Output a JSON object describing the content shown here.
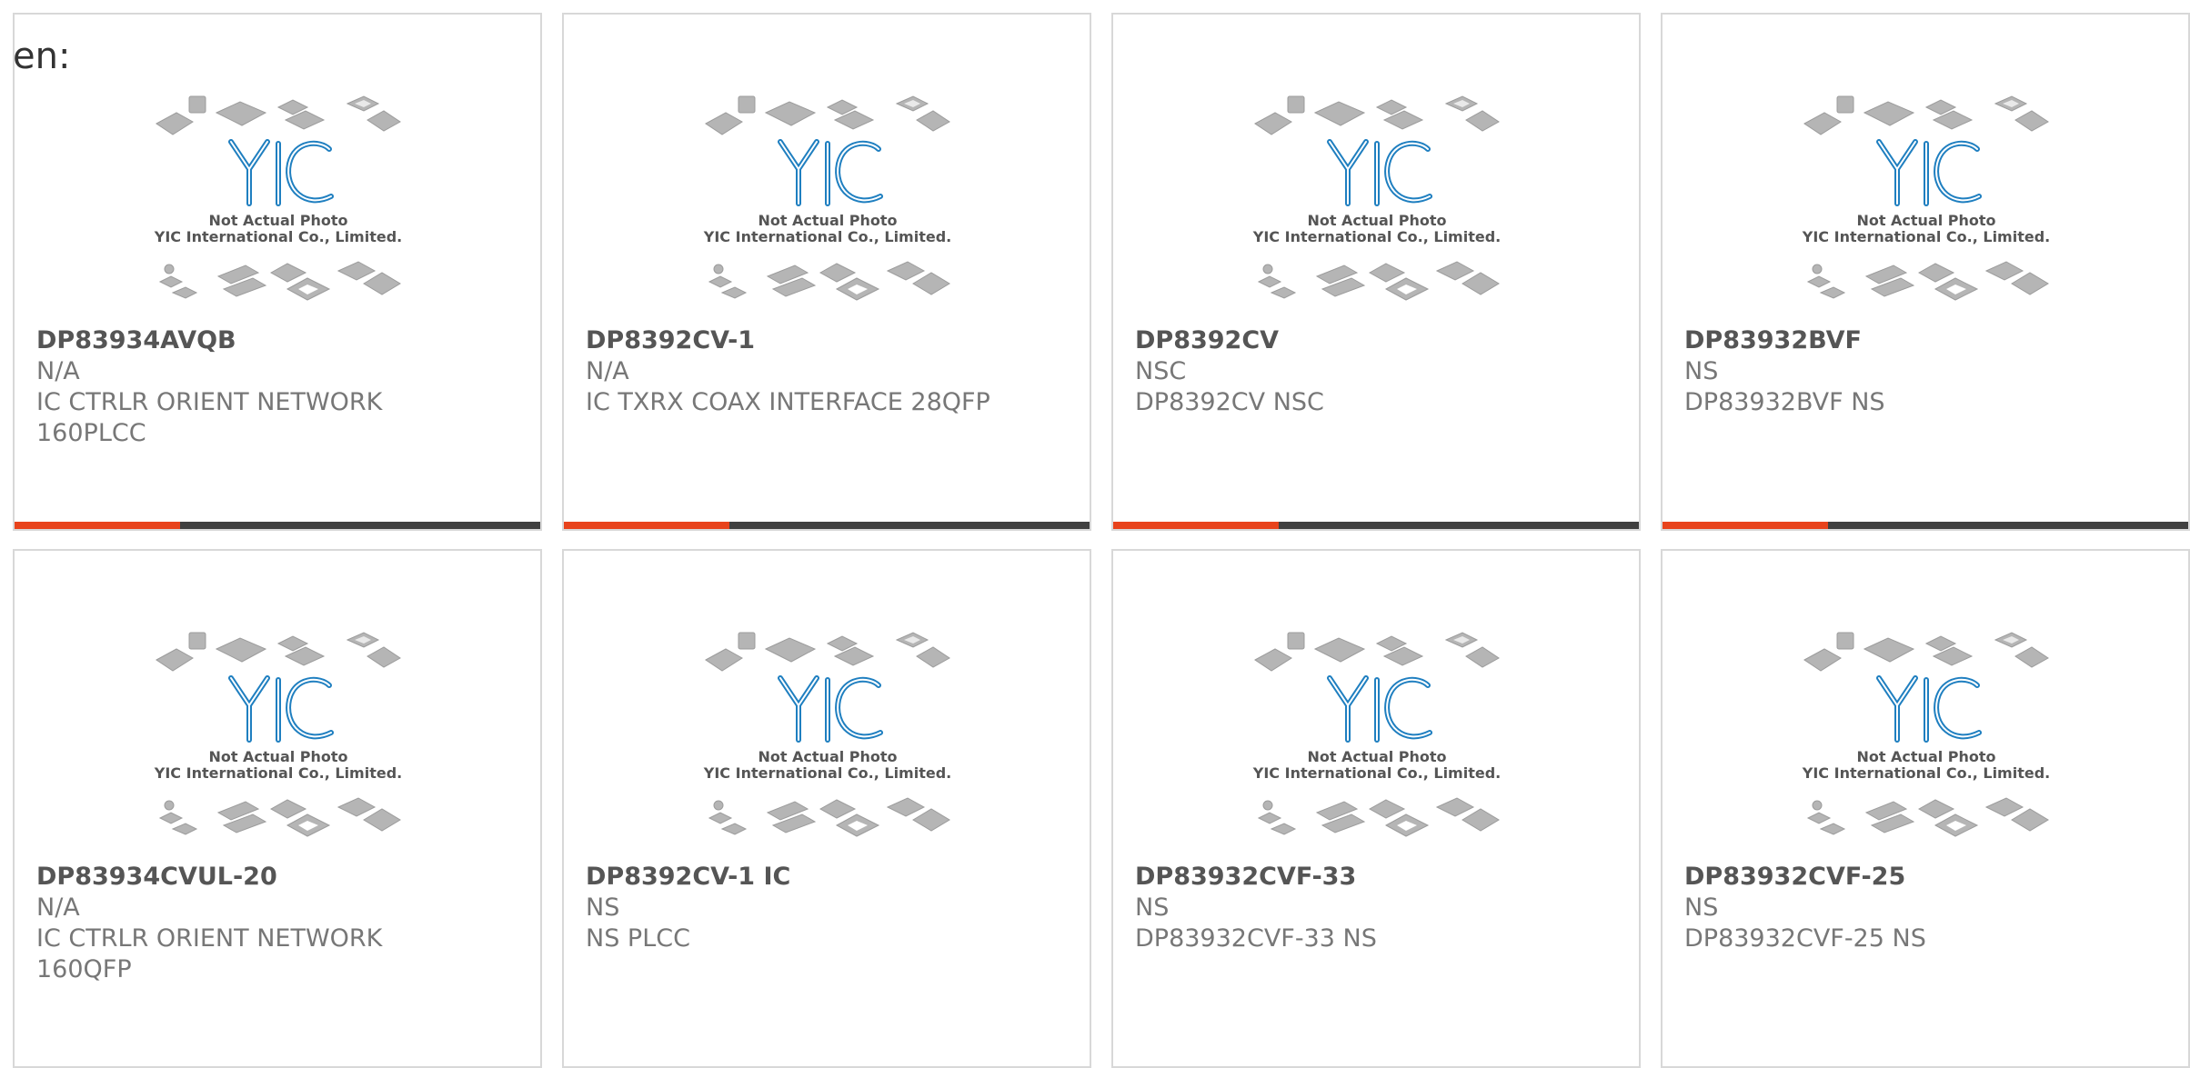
{
  "page": {
    "prefix_text": "en:"
  },
  "placeholder_image": {
    "logo_text": "YIC",
    "caption_line1": "Not Actual Photo",
    "caption_line2": "YIC International Co., Limited."
  },
  "colors": {
    "accent": "#e8431c",
    "bar": "#404040",
    "logo_blue": "#1f7fc0",
    "card_border": "#d8d8d8"
  },
  "products": [
    {
      "part_number": "DP83934AVQB",
      "manufacturer": "N/A",
      "desc_line1": "IC CTRLR ORIENT NETWORK",
      "desc_line2": "160PLCC"
    },
    {
      "part_number": "DP8392CV-1",
      "manufacturer": "N/A",
      "desc_line1": "IC TXRX COAX INTERFACE 28QFP",
      "desc_line2": ""
    },
    {
      "part_number": "DP8392CV",
      "manufacturer": "NSC",
      "desc_line1": "DP8392CV NSC",
      "desc_line2": ""
    },
    {
      "part_number": "DP83932BVF",
      "manufacturer": "NS",
      "desc_line1": "DP83932BVF NS",
      "desc_line2": ""
    },
    {
      "part_number": "DP83934CVUL-20",
      "manufacturer": "N/A",
      "desc_line1": "IC CTRLR ORIENT NETWORK",
      "desc_line2": "160QFP"
    },
    {
      "part_number": "DP8392CV-1 IC",
      "manufacturer": "NS",
      "desc_line1": "NS PLCC",
      "desc_line2": ""
    },
    {
      "part_number": "DP83932CVF-33",
      "manufacturer": "NS",
      "desc_line1": "DP83932CVF-33 NS",
      "desc_line2": ""
    },
    {
      "part_number": "DP83932CVF-25",
      "manufacturer": "NS",
      "desc_line1": "DP83932CVF-25 NS",
      "desc_line2": ""
    }
  ]
}
